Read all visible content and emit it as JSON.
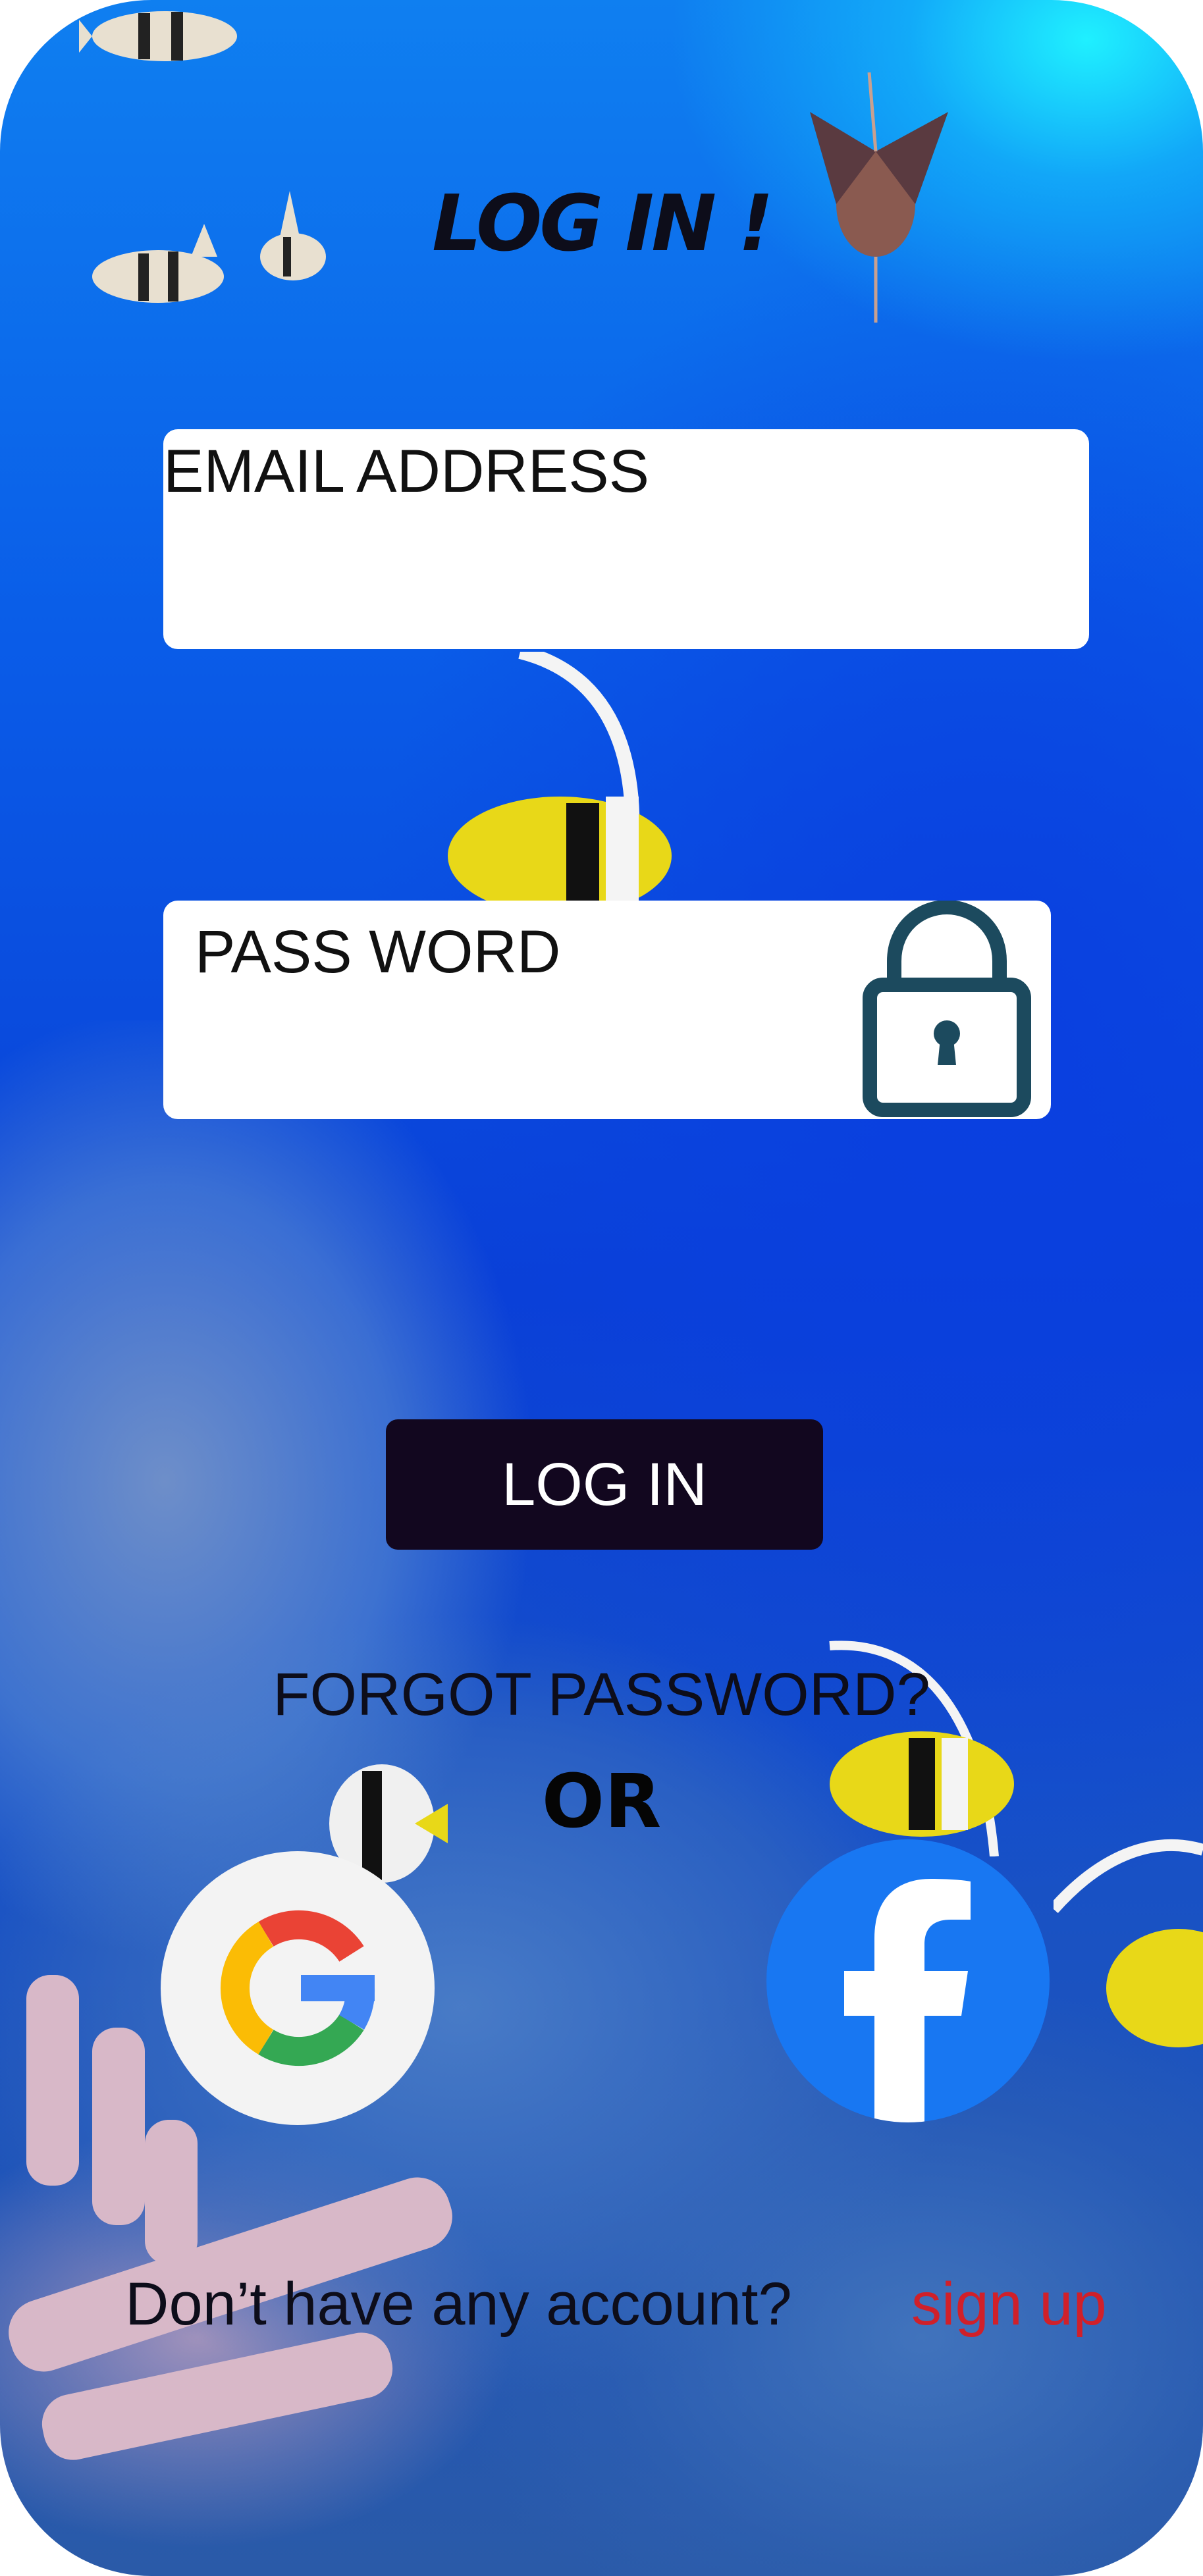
{
  "title": "LOG IN !",
  "email": {
    "label": "EMAIL ADDRESS"
  },
  "password": {
    "label": "PASS WORD",
    "icon": "lock-icon"
  },
  "login_button": "LOG IN",
  "forgot_password": "FORGOT PASSWORD?",
  "divider": "OR",
  "social": {
    "google_icon": "google-icon",
    "facebook_icon": "facebook-icon"
  },
  "footer": {
    "prompt": "Don’t have any account?",
    "signup": "sign up"
  },
  "colors": {
    "button": "#12071f",
    "signup": "#d0202a",
    "lock": "#1c4a5e",
    "facebook": "#1877f2"
  }
}
